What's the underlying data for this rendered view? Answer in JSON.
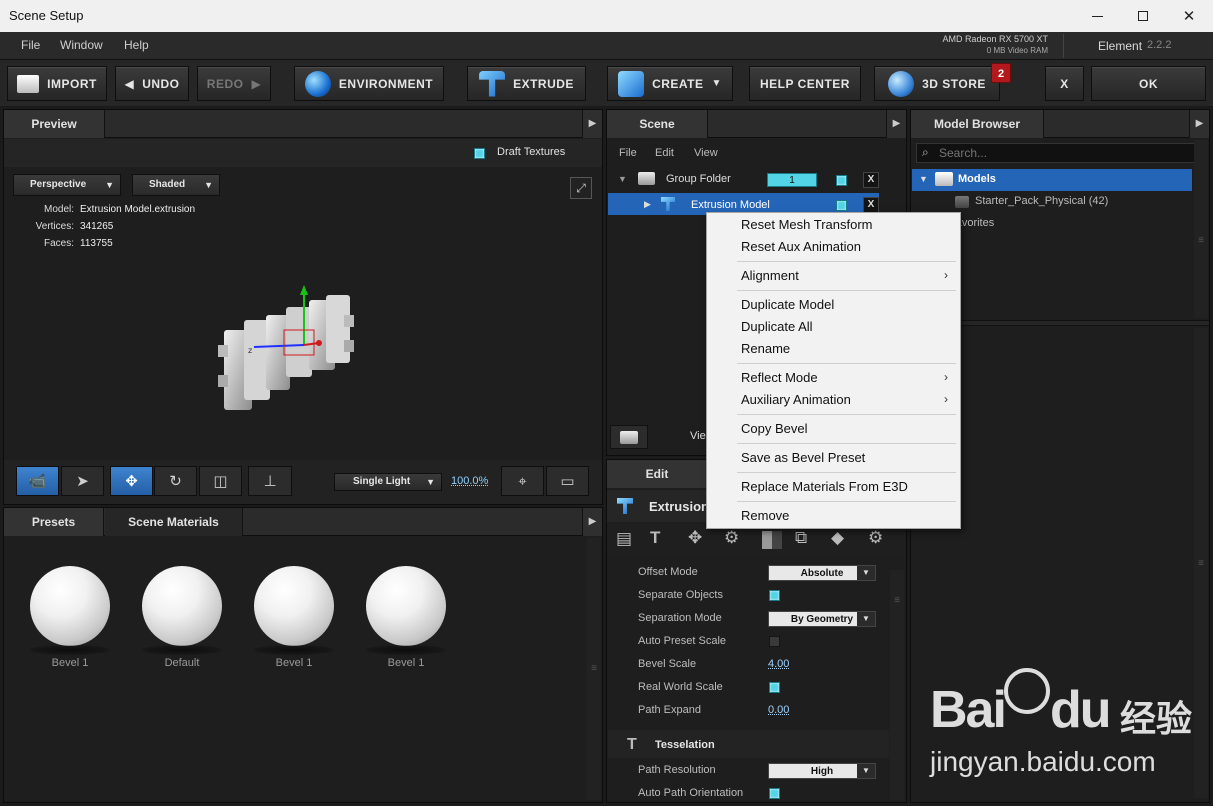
{
  "window": {
    "title": "Scene Setup"
  },
  "menu": {
    "items": [
      "File",
      "Window",
      "Help"
    ],
    "gpu_name": "AMD Radeon RX 5700 XT",
    "gpu_mem": "0 MB Video RAM",
    "app_name": "Element",
    "app_version": "2.2.2"
  },
  "toolbar": {
    "import": "IMPORT",
    "undo": "UNDO",
    "redo": "REDO",
    "environment": "ENVIRONMENT",
    "extrude": "EXTRUDE",
    "create": "CREATE",
    "help_center": "HELP CENTER",
    "store": "3D STORE",
    "store_badge": "2",
    "close": "X",
    "ok": "OK"
  },
  "preview": {
    "tab": "Preview",
    "draft_textures": "Draft Textures",
    "view_mode": "Perspective",
    "shade_mode": "Shaded",
    "model_label": "Model:",
    "model_value": "Extrusion Model.extrusion",
    "vertices_label": "Vertices:",
    "vertices_value": "341265",
    "faces_label": "Faces:",
    "faces_value": "113755",
    "light_mode": "Single Light",
    "zoom": "100.0%"
  },
  "presets": {
    "tabs": [
      "Presets",
      "Scene Materials"
    ],
    "items": [
      "Bevel 1",
      "Default",
      "Bevel 1",
      "Bevel 1"
    ]
  },
  "scene": {
    "tab": "Scene",
    "menu": [
      "File",
      "Edit",
      "View"
    ],
    "group_folder": "Group Folder",
    "group_count": "1",
    "model_name": "Extrusion Model",
    "view_label": "Vie"
  },
  "edit": {
    "tab": "Edit",
    "title": "Extrusion",
    "props": {
      "offset_mode": "Offset Mode",
      "offset_mode_val": "Absolute",
      "separate_objects": "Separate Objects",
      "separation_mode": "Separation Mode",
      "separation_mode_val": "By Geometry",
      "auto_preset_scale": "Auto Preset Scale",
      "bevel_scale": "Bevel Scale",
      "bevel_scale_val": "4.00",
      "real_world_scale": "Real World Scale",
      "path_expand": "Path Expand",
      "path_expand_val": "0.00",
      "tesselation": "Tesselation",
      "path_resolution": "Path Resolution",
      "path_resolution_val": "High",
      "auto_path_orientation": "Auto Path Orientation"
    }
  },
  "model_browser": {
    "tab": "Model Browser",
    "search_placeholder": "Search...",
    "root": "Models",
    "child": "Starter_Pack_Physical (42)",
    "favorites": "Favorites"
  },
  "context_menu": {
    "items": [
      "Reset Mesh Transform",
      "Reset Aux Animation",
      "Alignment",
      "Duplicate Model",
      "Duplicate All",
      "Rename",
      "Reflect Mode",
      "Auxiliary Animation",
      "Copy Bevel",
      "Save as Bevel Preset",
      "Replace Materials From E3D",
      "Remove"
    ]
  },
  "watermark": {
    "brand": "Bai",
    "brand2": "du",
    "cn": "经验",
    "url": "jingyan.baidu.com"
  }
}
